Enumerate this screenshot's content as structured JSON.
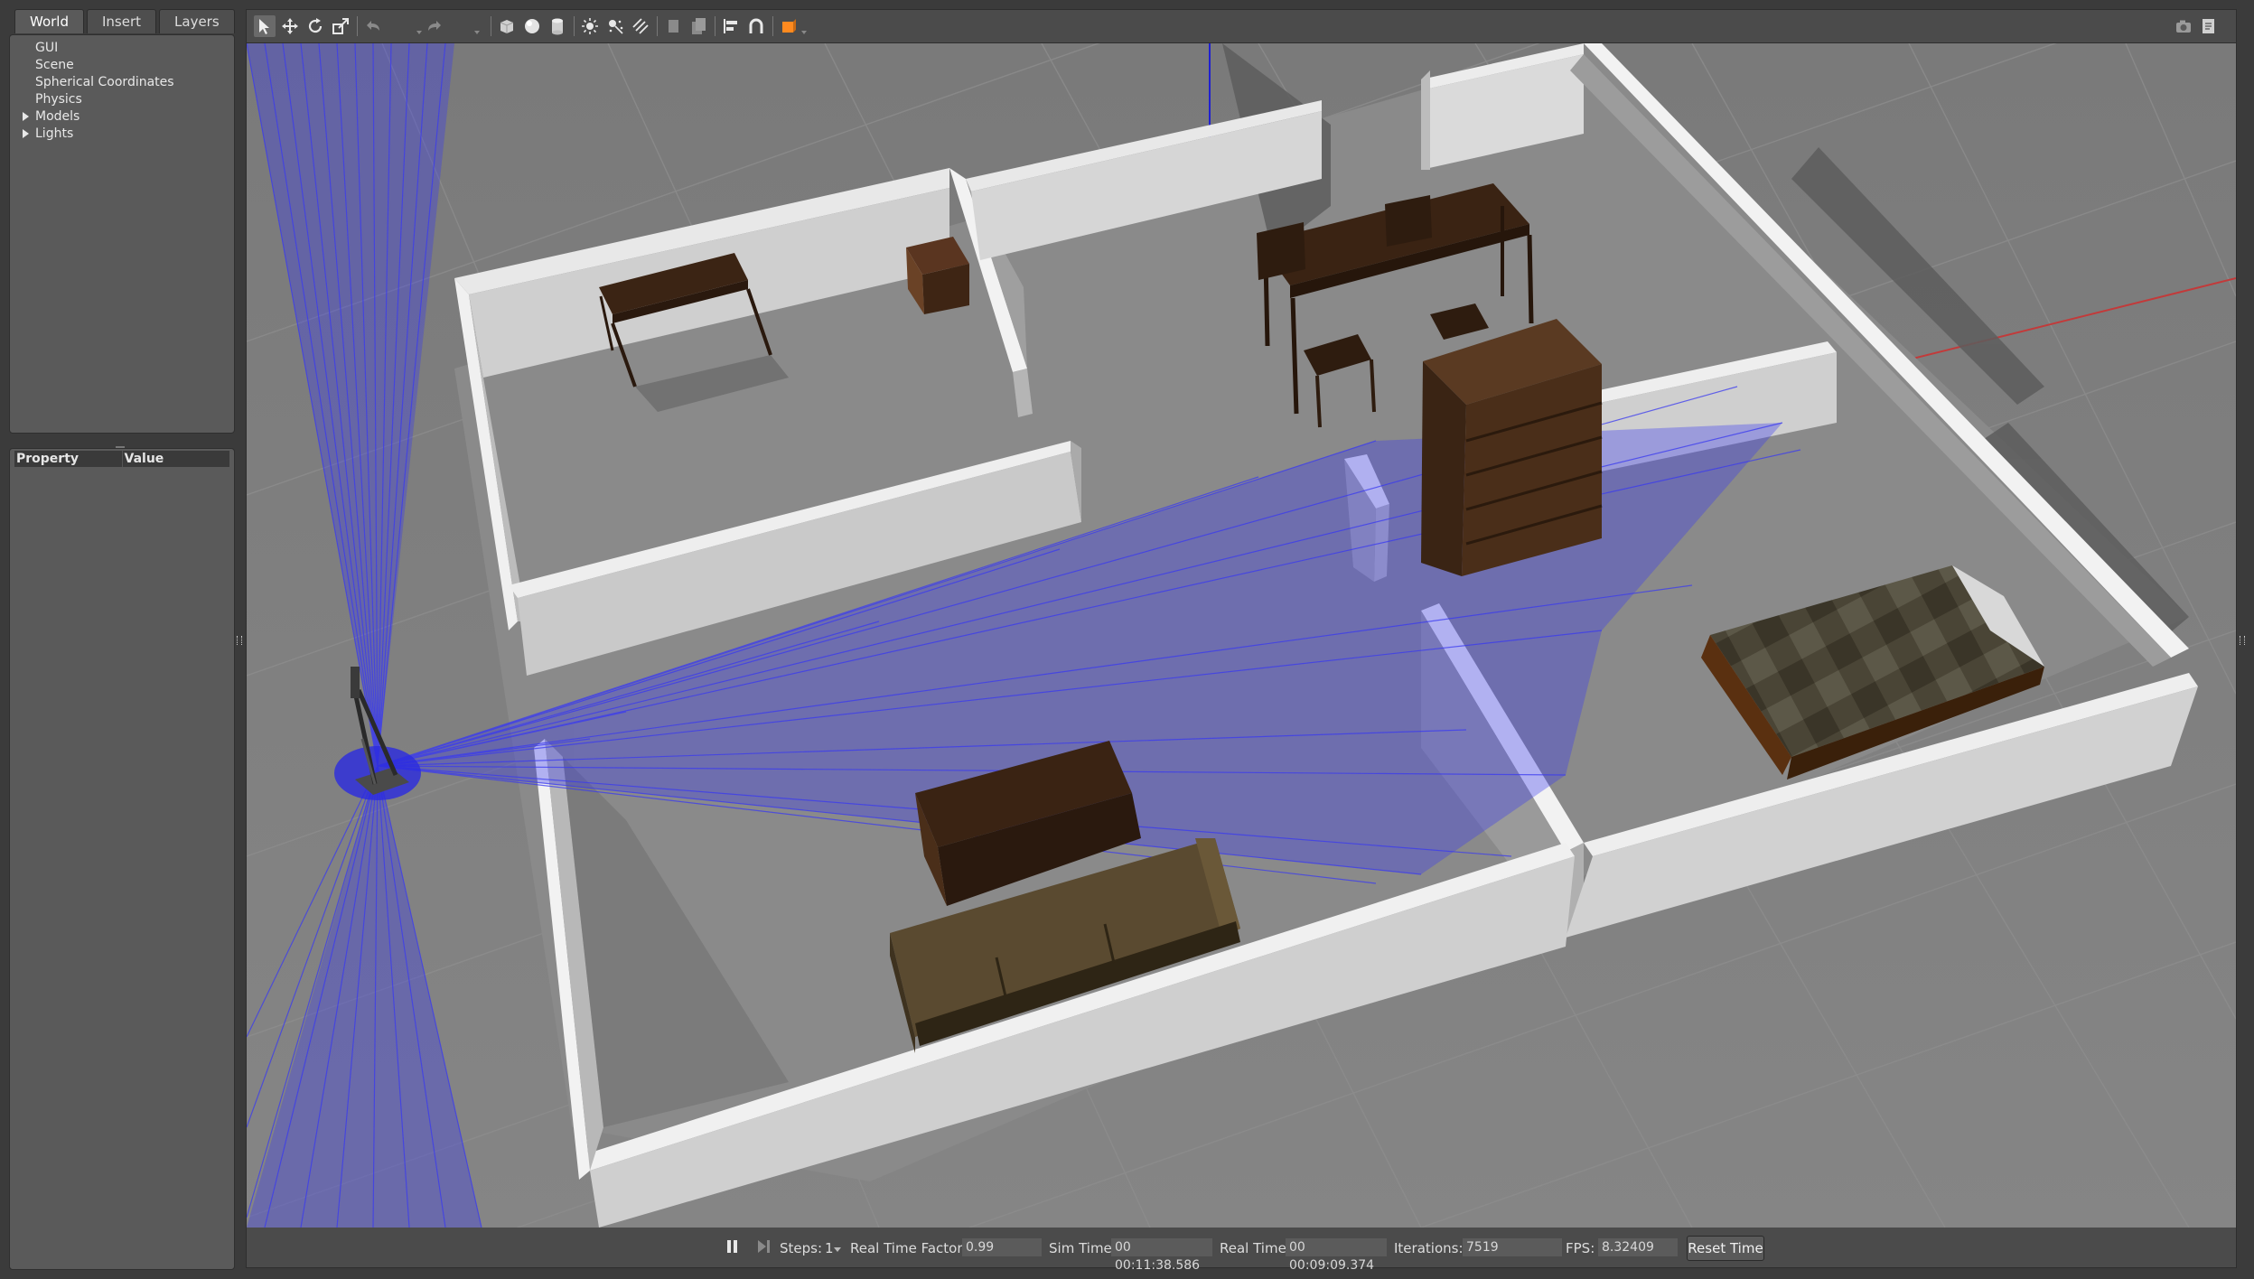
{
  "tabs": [
    {
      "label": "World"
    },
    {
      "label": "Insert"
    },
    {
      "label": "Layers"
    }
  ],
  "world_tree": {
    "items": [
      {
        "label": "GUI",
        "expandable": false
      },
      {
        "label": "Scene",
        "expandable": false
      },
      {
        "label": "Spherical Coordinates",
        "expandable": false
      },
      {
        "label": "Physics",
        "expandable": false
      },
      {
        "label": "Models",
        "expandable": true
      },
      {
        "label": "Lights",
        "expandable": true
      }
    ]
  },
  "property_panel": {
    "col_property": "Property",
    "col_value": "Value"
  },
  "toolbar": {
    "tools": [
      "select-mode-icon",
      "translate-mode-icon",
      "rotate-mode-icon",
      "scale-mode-icon",
      "undo-icon",
      "redo-icon",
      "box-shape-icon",
      "sphere-shape-icon",
      "cylinder-shape-icon",
      "point-light-icon",
      "spot-light-icon",
      "directional-light-icon",
      "copy-icon",
      "paste-icon",
      "align-icon",
      "snap-icon",
      "view-angle-icon",
      "screenshot-icon",
      "log-icon"
    ],
    "accent": "#ff8a1f"
  },
  "status": {
    "steps_label": "Steps:",
    "steps_value": "1",
    "rtf_label": "Real Time Factor:",
    "rtf_value": "0.99",
    "sim_time_label": "Sim Time:",
    "sim_time_value": "00 00:11:38.586",
    "real_time_label": "Real Time:",
    "real_time_value": "00 00:09:09.374",
    "iterations_label": "Iterations:",
    "iterations_value": "7519",
    "fps_label": "FPS:",
    "fps_value": "8.32409",
    "reset_label": "Reset Time"
  },
  "colors": {
    "ground": "#7f7f7f",
    "wall": "#d9d9d9",
    "laser": "#3a3af0",
    "wood": "#3b2414"
  }
}
